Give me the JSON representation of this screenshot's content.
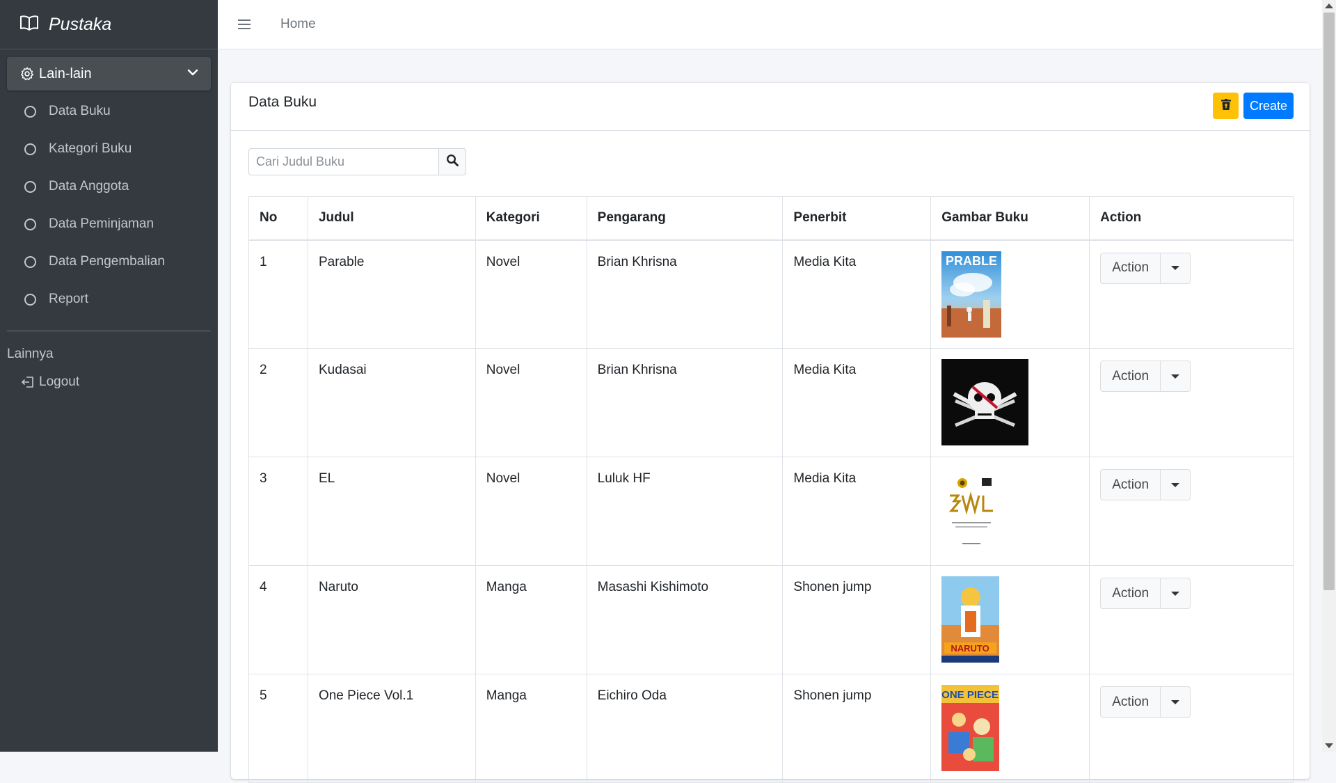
{
  "sidebar": {
    "brand": "Pustaka",
    "open_menu": "Lain-lain",
    "items": [
      {
        "label": "Data Buku"
      },
      {
        "label": "Kategori Buku"
      },
      {
        "label": "Data Anggota"
      },
      {
        "label": "Data Peminjaman"
      },
      {
        "label": "Data Pengembalian"
      },
      {
        "label": "Report"
      }
    ],
    "section_header": "Lainnya",
    "logout": "Logout"
  },
  "topbar": {
    "home": "Home"
  },
  "card": {
    "title": "Data Buku",
    "create_label": "Create",
    "search_placeholder": "Cari Judul Buku"
  },
  "table": {
    "headers": [
      "No",
      "Judul",
      "Kategori",
      "Pengarang",
      "Penerbit",
      "Gambar Buku",
      "Action"
    ],
    "rows": [
      {
        "no": "1",
        "judul": "Parable",
        "kategori": "Novel",
        "pengarang": "Brian Khrisna",
        "penerbit": "Media Kita",
        "action": "Action"
      },
      {
        "no": "2",
        "judul": "Kudasai",
        "kategori": "Novel",
        "pengarang": "Brian Khrisna",
        "penerbit": "Media Kita",
        "action": "Action"
      },
      {
        "no": "3",
        "judul": "EL",
        "kategori": "Novel",
        "pengarang": "Luluk HF",
        "penerbit": "Media Kita",
        "action": "Action"
      },
      {
        "no": "4",
        "judul": "Naruto",
        "kategori": "Manga",
        "pengarang": "Masashi Kishimoto",
        "penerbit": "Shonen jump",
        "action": "Action"
      },
      {
        "no": "5",
        "judul": "One Piece Vol.1",
        "kategori": "Manga",
        "pengarang": "Eichiro Oda",
        "penerbit": "Shonen jump",
        "action": "Action"
      }
    ]
  },
  "colors": {
    "sidebar_bg": "#343a40",
    "primary": "#007bff",
    "warning": "#ffc107",
    "content_bg": "#f4f6f9"
  }
}
